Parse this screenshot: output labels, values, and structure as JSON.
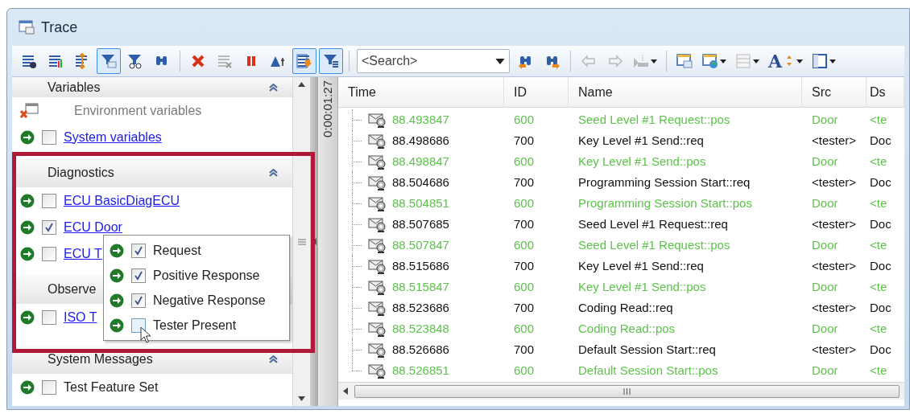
{
  "window": {
    "title": "Trace"
  },
  "toolbar": {
    "groups_before": [
      [
        {
          "kind": "list-gear",
          "selected": false,
          "disabled": false,
          "dropdown": false
        },
        {
          "kind": "list-chart",
          "selected": false,
          "disabled": false,
          "dropdown": false
        },
        {
          "kind": "list-resize",
          "selected": false,
          "disabled": false,
          "dropdown": false
        },
        {
          "kind": "funnel-envelope",
          "selected": true,
          "disabled": false,
          "dropdown": false
        },
        {
          "kind": "funnel-glasses",
          "selected": false,
          "disabled": false,
          "dropdown": false
        },
        {
          "kind": "binoculars",
          "selected": false,
          "disabled": false,
          "dropdown": false
        }
      ],
      [
        {
          "kind": "delete",
          "selected": false,
          "disabled": false,
          "dropdown": false
        },
        {
          "kind": "list-x",
          "selected": false,
          "disabled": true,
          "dropdown": false
        },
        {
          "kind": "pause",
          "selected": false,
          "disabled": false,
          "dropdown": false
        },
        {
          "kind": "triangle-t",
          "selected": false,
          "disabled": false,
          "dropdown": false
        },
        {
          "kind": "list-down",
          "selected": true,
          "disabled": false,
          "dropdown": false
        },
        {
          "kind": "funnel-list",
          "selected": true,
          "disabled": false,
          "dropdown": false
        }
      ]
    ],
    "search": {
      "placeholder": "<Search>"
    },
    "groups_after": [
      [
        {
          "kind": "find-prev",
          "selected": false,
          "disabled": false,
          "dropdown": false
        },
        {
          "kind": "find-next",
          "selected": false,
          "disabled": false,
          "dropdown": false
        }
      ],
      [
        {
          "kind": "back",
          "selected": false,
          "disabled": true,
          "dropdown": false
        },
        {
          "kind": "forward",
          "selected": false,
          "disabled": true,
          "dropdown": false
        },
        {
          "kind": "marker",
          "selected": false,
          "disabled": true,
          "dropdown": true
        }
      ],
      [
        {
          "kind": "window-envelope",
          "selected": false,
          "disabled": false,
          "dropdown": false
        },
        {
          "kind": "window-globe",
          "selected": false,
          "disabled": false,
          "dropdown": true
        },
        {
          "kind": "layout",
          "selected": false,
          "disabled": true,
          "dropdown": true
        },
        {
          "kind": "font-size",
          "glyph": "A",
          "selected": false,
          "disabled": false,
          "dropdown": true
        },
        {
          "kind": "window",
          "selected": false,
          "disabled": false,
          "dropdown": true
        }
      ]
    ]
  },
  "sidebar": {
    "sections": [
      {
        "title": "Variables",
        "items": [
          {
            "kind": "unavailable",
            "label": "Environment variables"
          },
          {
            "kind": "link",
            "label": "System variables",
            "checked": false
          }
        ]
      },
      {
        "title": "Diagnostics",
        "items": [
          {
            "kind": "link",
            "label": "ECU BasicDiagECU",
            "checked": false
          },
          {
            "kind": "link",
            "label": "ECU Door",
            "checked": true
          },
          {
            "kind": "link",
            "label": "ECU T",
            "checked": false
          }
        ]
      },
      {
        "title": "Observe",
        "items": [
          {
            "kind": "link",
            "label": "ISO T",
            "checked": false
          }
        ]
      },
      {
        "title": "System Messages",
        "items": [
          {
            "kind": "plain",
            "label": "Test Feature Set",
            "checked": false
          }
        ]
      }
    ],
    "popup": {
      "items": [
        {
          "label": "Request",
          "checked": true,
          "hovered": false
        },
        {
          "label": "Positive Response",
          "checked": true,
          "hovered": false
        },
        {
          "label": "Negative Response",
          "checked": true,
          "hovered": false
        },
        {
          "label": "Tester Present",
          "checked": false,
          "hovered": true
        }
      ]
    }
  },
  "elapsed": "0:00:01:27",
  "table": {
    "columns": [
      "Time",
      "ID",
      "Name",
      "Src",
      "Ds"
    ],
    "rows": [
      {
        "kind": "response",
        "time": "88.493847",
        "id": "600",
        "name": "Seed Level #1 Request::pos",
        "src": "Door",
        "dst": "<te"
      },
      {
        "kind": "request",
        "time": "88.498686",
        "id": "700",
        "name": "Key Level #1 Send::req",
        "src": "<tester>",
        "dst": "Doc"
      },
      {
        "kind": "response",
        "time": "88.498847",
        "id": "600",
        "name": "Key Level #1 Send::pos",
        "src": "Door",
        "dst": "<te"
      },
      {
        "kind": "request",
        "time": "88.504686",
        "id": "700",
        "name": "Programming Session Start::req",
        "src": "<tester>",
        "dst": "Doc"
      },
      {
        "kind": "response",
        "time": "88.504851",
        "id": "600",
        "name": "Programming Session Start::pos",
        "src": "Door",
        "dst": "<te"
      },
      {
        "kind": "request",
        "time": "88.507685",
        "id": "700",
        "name": "Seed Level #1 Request::req",
        "src": "<tester>",
        "dst": "Doc"
      },
      {
        "kind": "response",
        "time": "88.507847",
        "id": "600",
        "name": "Seed Level #1 Request::pos",
        "src": "Door",
        "dst": "<te"
      },
      {
        "kind": "request",
        "time": "88.515686",
        "id": "700",
        "name": "Key Level #1 Send::req",
        "src": "<tester>",
        "dst": "Doc"
      },
      {
        "kind": "response",
        "time": "88.515847",
        "id": "600",
        "name": "Key Level #1 Send::pos",
        "src": "Door",
        "dst": "<te"
      },
      {
        "kind": "request",
        "time": "88.523686",
        "id": "700",
        "name": "Coding Read::req",
        "src": "<tester>",
        "dst": "Doc"
      },
      {
        "kind": "response",
        "time": "88.523848",
        "id": "600",
        "name": "Coding Read::pos",
        "src": "Door",
        "dst": "<te"
      },
      {
        "kind": "request",
        "time": "88.526686",
        "id": "700",
        "name": "Default Session Start::req",
        "src": "<tester>",
        "dst": "Doc"
      },
      {
        "kind": "response",
        "time": "88.526851",
        "id": "600",
        "name": "Default Session Start::pos",
        "src": "Door",
        "dst": "<te"
      }
    ]
  }
}
